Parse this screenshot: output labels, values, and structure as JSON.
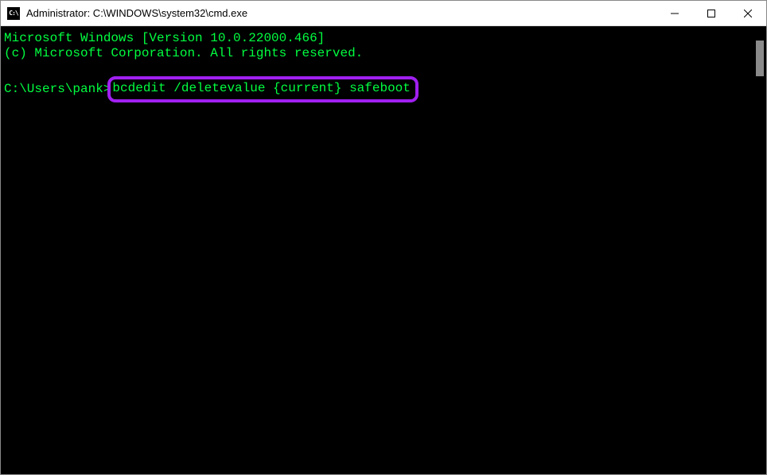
{
  "window": {
    "title": "Administrator: C:\\WINDOWS\\system32\\cmd.exe",
    "icon_label": "C:\\"
  },
  "terminal": {
    "line1": "Microsoft Windows [Version 10.0.22000.466]",
    "line2": "(c) Microsoft Corporation. All rights reserved.",
    "prompt": "C:\\Users\\pank>",
    "command": "bcdedit /deletevalue {current} safeboot"
  },
  "highlight": {
    "color": "#a020f0"
  }
}
